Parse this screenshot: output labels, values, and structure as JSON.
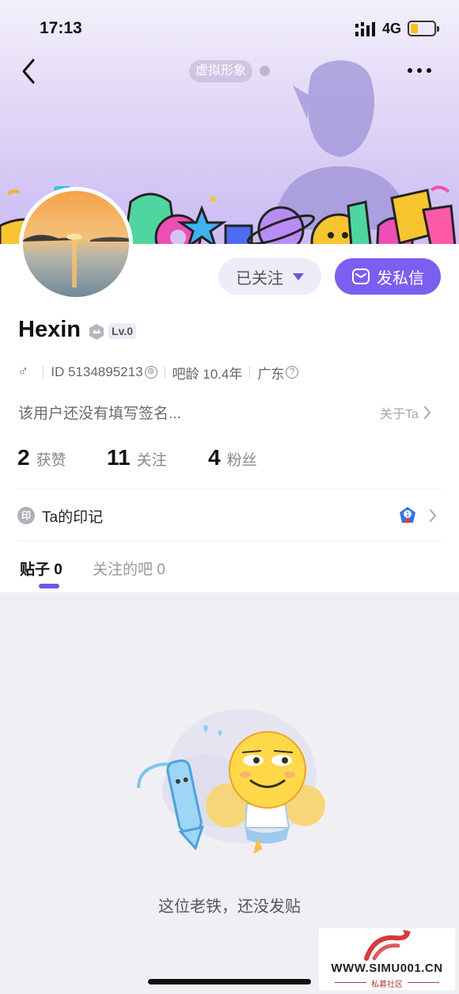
{
  "status_bar": {
    "time": "17:13",
    "network": "4G"
  },
  "header": {
    "avatar_chip": "虚拟形象"
  },
  "profile": {
    "name": "Hexin",
    "level": "Lv.0",
    "gender_symbol": "♂",
    "id_text": "ID 5134895213",
    "age_text": "吧龄 10.4年",
    "location": "广东",
    "signature": "该用户还没有填写签名...",
    "about_label": "关于Ta"
  },
  "actions": {
    "follow_label": "已关注",
    "message_label": "发私信"
  },
  "stats": [
    {
      "num": "2",
      "label": "获赞"
    },
    {
      "num": "11",
      "label": "关注"
    },
    {
      "num": "4",
      "label": "粉丝"
    }
  ],
  "seal": {
    "icon_text": "印",
    "label": "Ta的印记"
  },
  "tabs": [
    {
      "label": "贴子 0",
      "active": true
    },
    {
      "label": "关注的吧 0",
      "active": false
    }
  ],
  "empty_state": {
    "text": "这位老铁，还没发贴"
  },
  "watermark": {
    "url": "WWW.SIMU001.CN",
    "subtitle": "私募社区"
  },
  "colors": {
    "accent": "#7b5ff0",
    "banner": "#d3c6f4"
  }
}
